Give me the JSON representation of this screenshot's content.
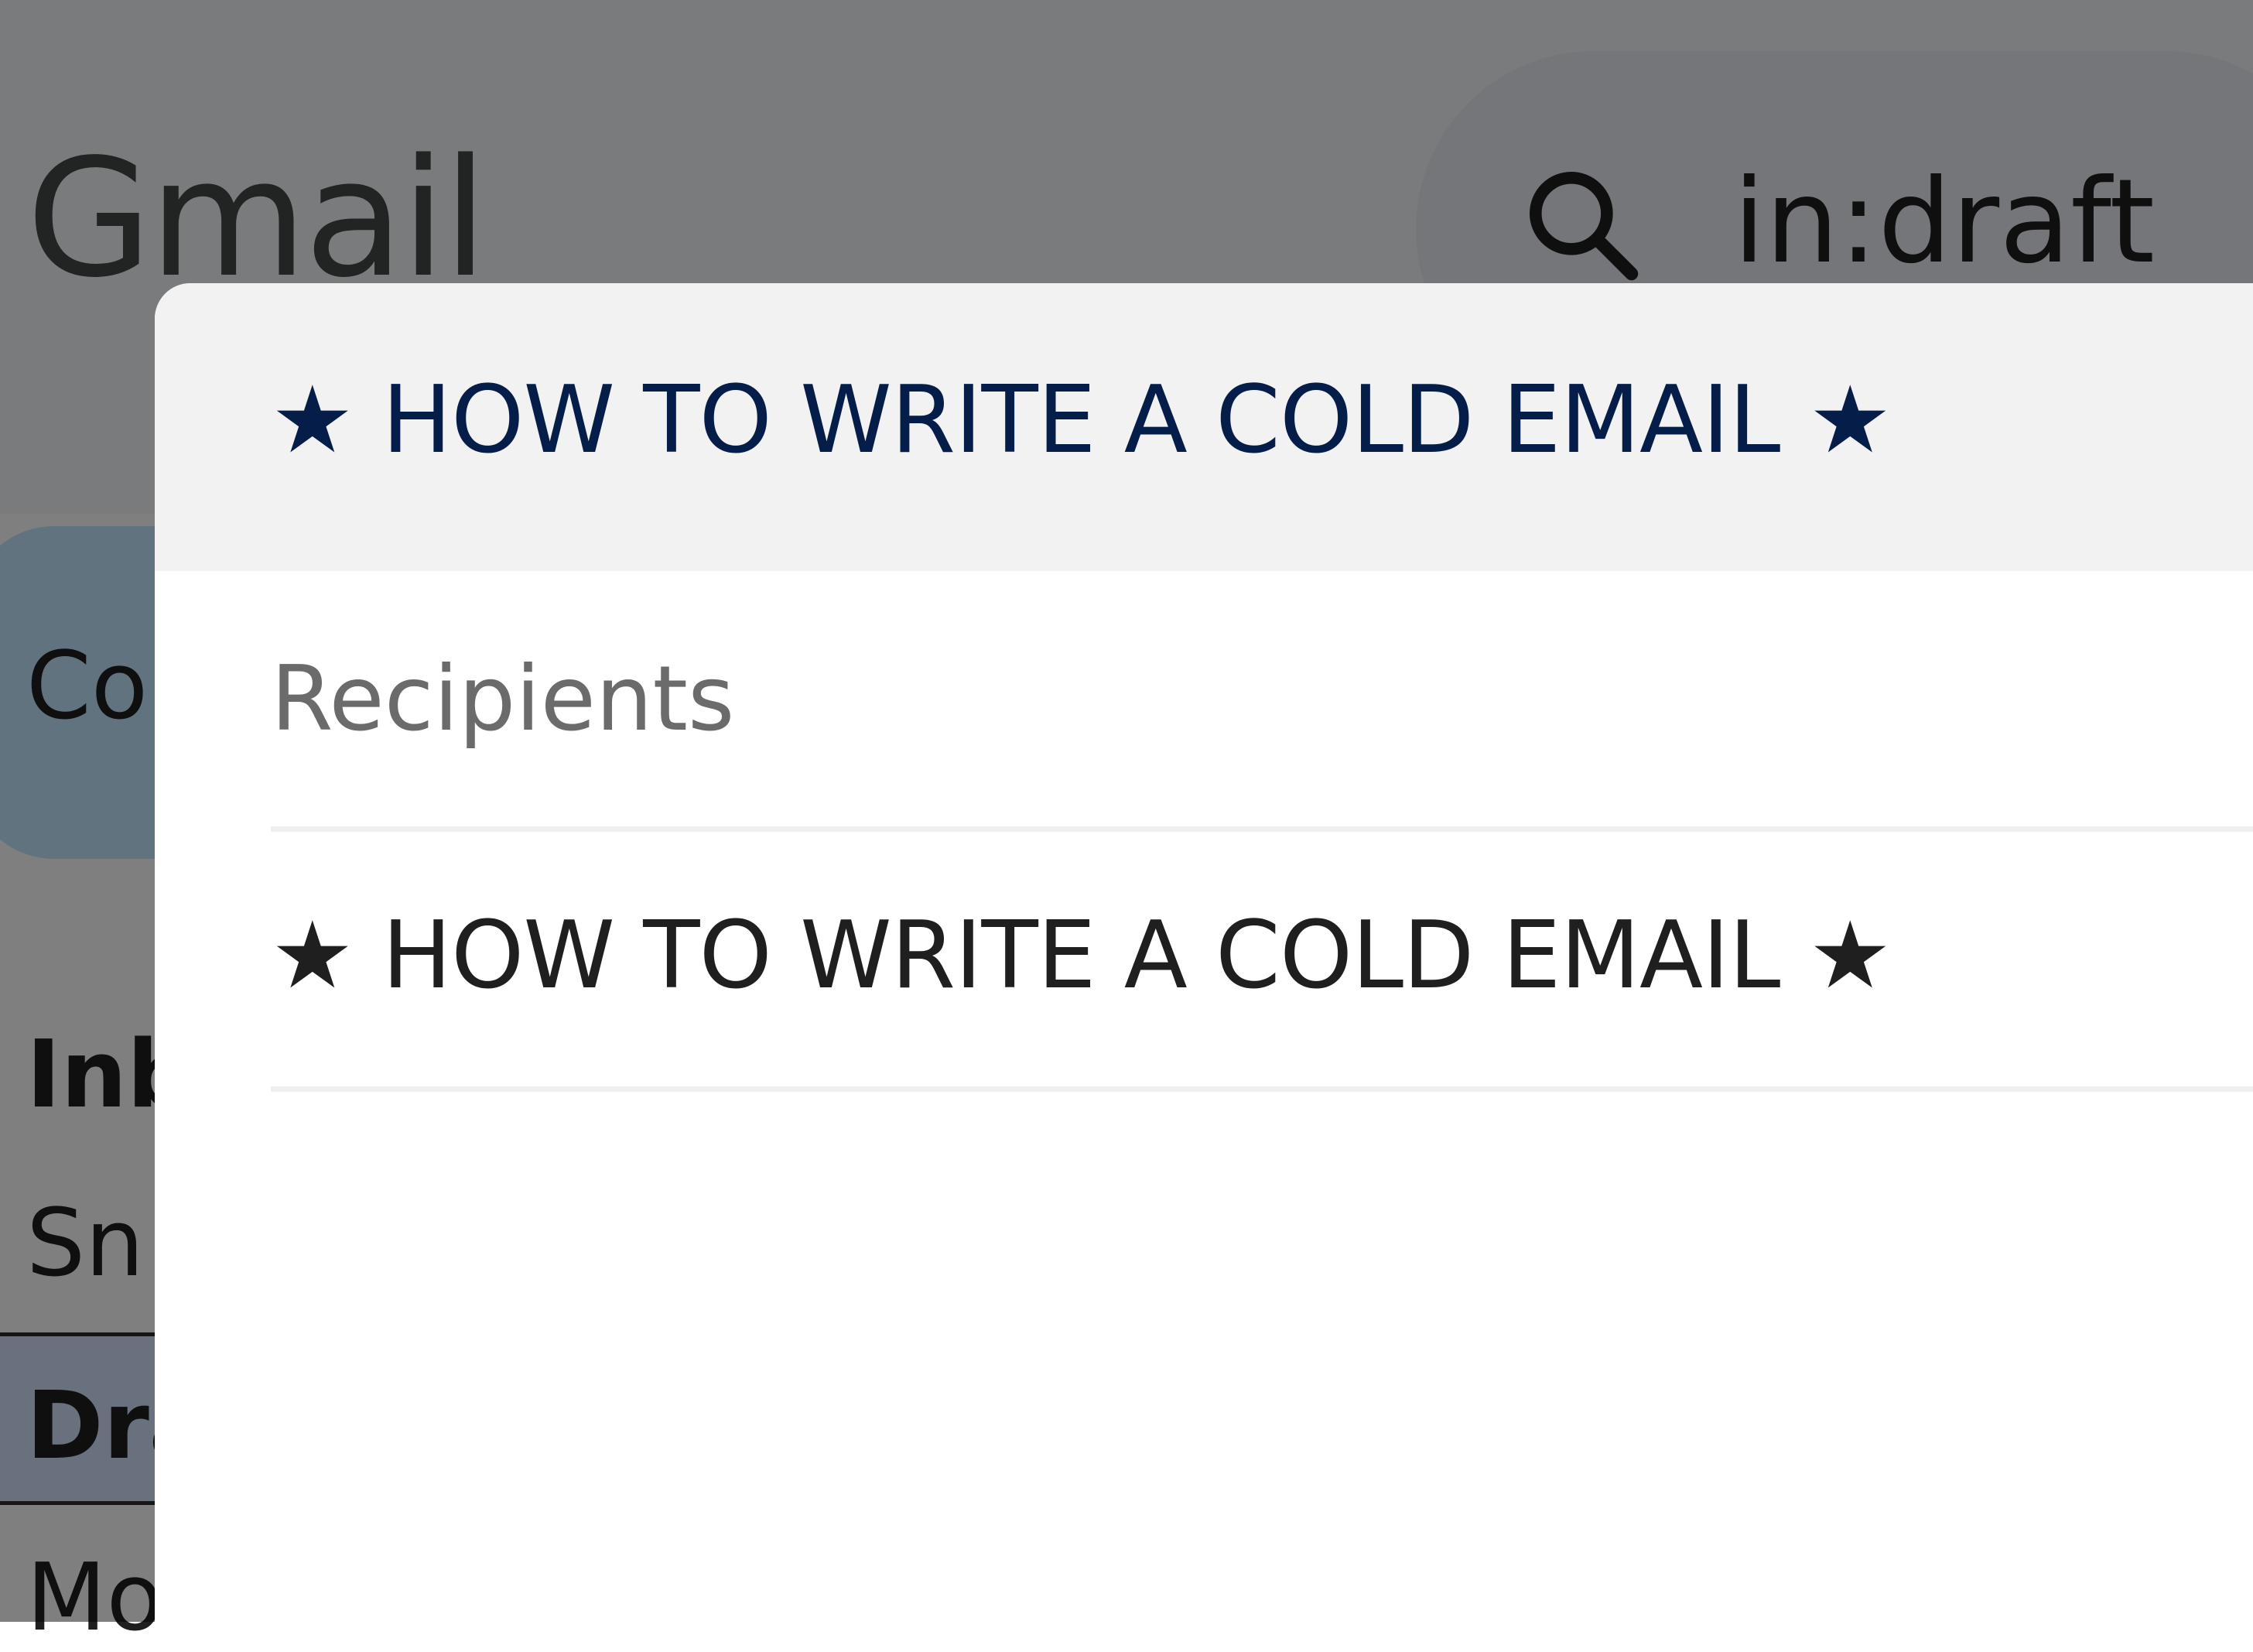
{
  "app": {
    "logo_text": "Gmail"
  },
  "search": {
    "query": "in:draft",
    "icon": "search-icon"
  },
  "sidebar": {
    "compose_label": "Co",
    "items": [
      {
        "label": "Inb",
        "bold": true
      },
      {
        "label": "Sn",
        "bold": false
      },
      {
        "label": "Dra",
        "bold": true
      },
      {
        "label": "Mo",
        "bold": false
      }
    ]
  },
  "dialog": {
    "title": "★ HOW TO WRITE A COLD EMAIL ★",
    "recipients_placeholder": "Recipients",
    "subject": "★ HOW TO WRITE A COLD EMAIL ★"
  },
  "colors": {
    "title_text": "#041e49",
    "titlebar_bg": "#f2f2f2",
    "overlay": "rgba(0,0,0,0.5)",
    "placeholder_text": "#6b6b6b"
  }
}
